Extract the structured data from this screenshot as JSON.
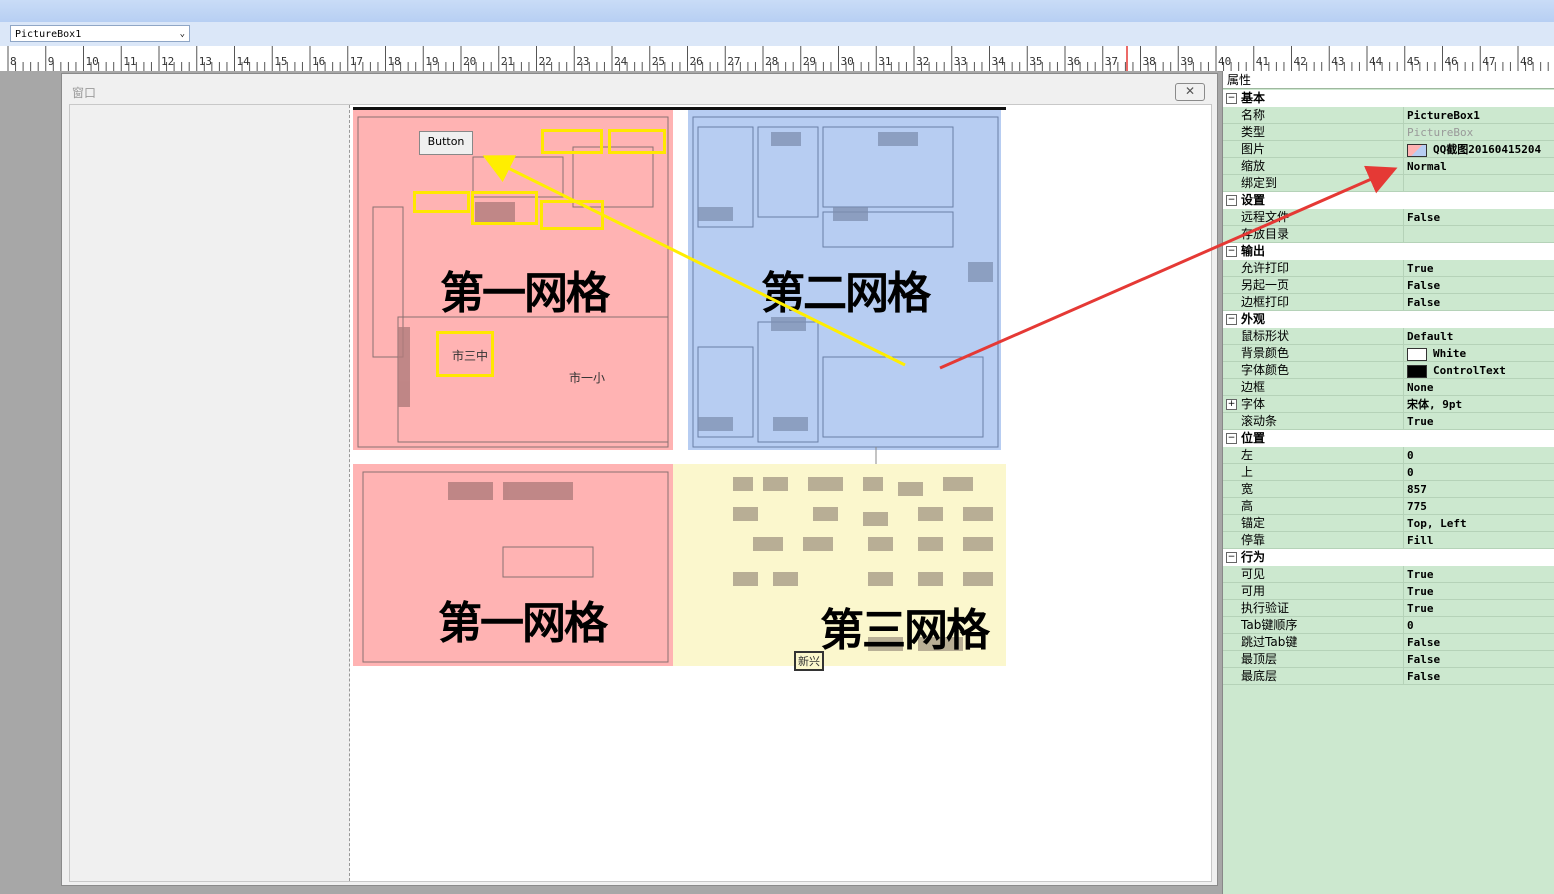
{
  "toolbar": {
    "combo_value": "PictureBox1"
  },
  "ruler": {
    "ticks": [
      "8",
      "9",
      "10",
      "11",
      "12",
      "13",
      "14",
      "15",
      "16",
      "17",
      "18",
      "19",
      "20",
      "21",
      "22",
      "23",
      "24",
      "25",
      "26",
      "27",
      "28",
      "29",
      "30",
      "31",
      "32",
      "33",
      "34",
      "35",
      "36",
      "37",
      "38",
      "39",
      "40",
      "41",
      "42",
      "43",
      "44",
      "45",
      "46",
      "47",
      "48"
    ]
  },
  "window": {
    "title": "窗口",
    "close_label": "✕"
  },
  "map": {
    "button_label": "Button",
    "label_grid1_top": "第一网格",
    "label_grid2": "第二网格",
    "label_grid1_bottom": "第一网格",
    "label_grid3": "第三网格",
    "label_school3": "市三中",
    "label_school1": "市一小",
    "label_xinxing": "新兴"
  },
  "properties": {
    "title": "属性",
    "rows": [
      {
        "type": "cat",
        "toggle": "⊟",
        "name": "基本"
      },
      {
        "type": "sub",
        "name": "名称",
        "value": "PictureBox1"
      },
      {
        "type": "sub",
        "name": "类型",
        "value": "PictureBox",
        "muted": true
      },
      {
        "type": "sub",
        "name": "图片",
        "value": "QQ截图20160415204",
        "swatch": "image"
      },
      {
        "type": "sub",
        "name": "缩放",
        "value": "Normal"
      },
      {
        "type": "sub",
        "name": "绑定到",
        "value": ""
      },
      {
        "type": "cat",
        "toggle": "⊟",
        "name": "设置"
      },
      {
        "type": "sub",
        "name": "远程文件",
        "value": "False"
      },
      {
        "type": "sub",
        "name": "存放目录",
        "value": ""
      },
      {
        "type": "cat",
        "toggle": "⊟",
        "name": "输出"
      },
      {
        "type": "sub",
        "name": "允许打印",
        "value": "True"
      },
      {
        "type": "sub",
        "name": "另起一页",
        "value": "False"
      },
      {
        "type": "sub",
        "name": "边框打印",
        "value": "False"
      },
      {
        "type": "cat",
        "toggle": "⊟",
        "name": "外观"
      },
      {
        "type": "sub",
        "name": "鼠标形状",
        "value": "Default"
      },
      {
        "type": "sub",
        "name": "背景颜色",
        "value": "White",
        "swatch": "#ffffff"
      },
      {
        "type": "sub",
        "name": "字体颜色",
        "value": "ControlText",
        "swatch": "#000000"
      },
      {
        "type": "sub",
        "name": "边框",
        "value": "None"
      },
      {
        "type": "sub",
        "toggle": "⊞",
        "name": "字体",
        "value": "宋体, 9pt"
      },
      {
        "type": "sub",
        "name": "滚动条",
        "value": "True"
      },
      {
        "type": "cat",
        "toggle": "⊟",
        "name": "位置"
      },
      {
        "type": "sub",
        "name": "左",
        "value": "0"
      },
      {
        "type": "sub",
        "name": "上",
        "value": "0"
      },
      {
        "type": "sub",
        "name": "宽",
        "value": "857"
      },
      {
        "type": "sub",
        "name": "高",
        "value": "775"
      },
      {
        "type": "sub",
        "name": "锚定",
        "value": "Top, Left"
      },
      {
        "type": "sub",
        "name": "停靠",
        "value": "Fill"
      },
      {
        "type": "cat",
        "toggle": "⊟",
        "name": "行为"
      },
      {
        "type": "sub",
        "name": "可见",
        "value": "True"
      },
      {
        "type": "sub",
        "name": "可用",
        "value": "True"
      },
      {
        "type": "sub",
        "name": "执行验证",
        "value": "True"
      },
      {
        "type": "sub",
        "name": "Tab键顺序",
        "value": "0"
      },
      {
        "type": "sub",
        "name": "跳过Tab键",
        "value": "False"
      },
      {
        "type": "sub",
        "name": "最顶层",
        "value": "False"
      },
      {
        "type": "sub",
        "name": "最底层",
        "value": "False"
      }
    ]
  },
  "colors": {
    "grid1": "#ffb3b3",
    "grid2": "#b7cdf2",
    "grid3": "#fbf7cd",
    "panel": "#cce8cf",
    "arrow_red": "#e53935",
    "arrow_yellow": "#ffee00"
  }
}
